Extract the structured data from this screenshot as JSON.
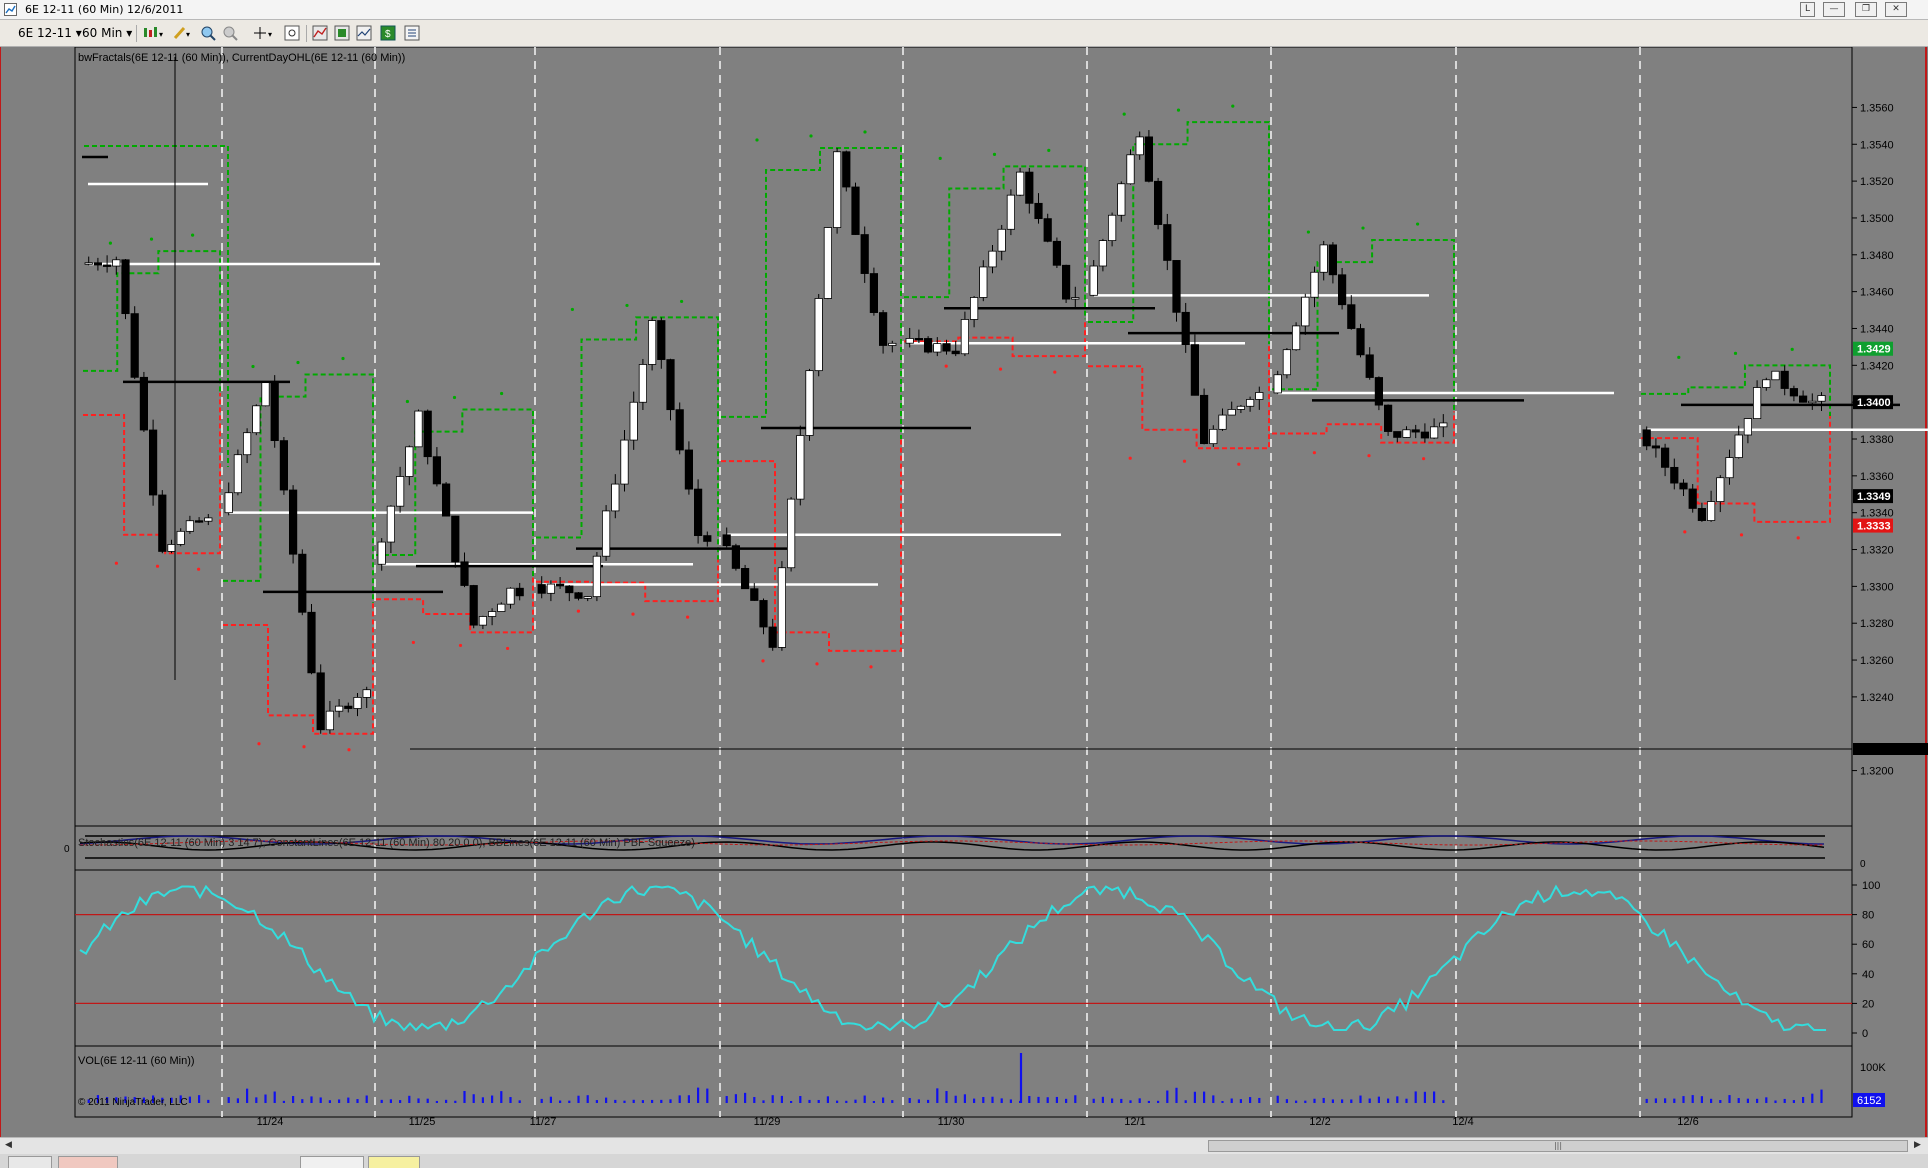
{
  "window": {
    "title": "6E 12-11 (60 Min)  12/6/2011",
    "link_button": "L",
    "minimize_label": "—",
    "restore_label": "❐",
    "close_label": "✕"
  },
  "toolbar": {
    "instrument": "6E 12-11",
    "interval": "60 Min"
  },
  "panels": {
    "price_label": "bwFractals(6E 12-11 (60 Min)), CurrentDayOHL(6E 12-11 (60 Min))",
    "stoch_label": "Stochastics(6E 12-11 (60 Min) 3 14 7), ConstantLines(6E 12-11 (60 Min) 80 20 0 0), BBLines(6E 12-11 (60 Min) PBF Squeeze)",
    "stoch_zero_label": "0",
    "stoch_axis_zero": "0",
    "vol_label": "VOL(6E 12-11 (60 Min))",
    "copyright": "© 2011 NinjaTrader, LLC"
  },
  "colors": {
    "chart_bg": "#808080",
    "bull_candle": "#ffffff",
    "bear_candle": "#000000",
    "fractal_up": "#00aa00",
    "fractal_down": "#ff2020",
    "stochastic": "#33dddd",
    "volume": "#1010ee",
    "grid_dash": "#d8d8d8",
    "constant_line": "#c01818"
  },
  "price_axis": {
    "ticks": [
      "1.3560",
      "1.3540",
      "1.3520",
      "1.3500",
      "1.3480",
      "1.3460",
      "1.3440",
      "1.3420",
      "1.3400",
      "1.3380",
      "1.3360",
      "1.3340",
      "1.3320",
      "1.3300",
      "1.3280",
      "1.3260",
      "1.3240",
      "1.3200"
    ],
    "markers": [
      {
        "text": "1.3429",
        "bg": "#0f9f2f",
        "fg": "#ffffff",
        "price": 1.3429
      },
      {
        "text": "1.3400",
        "bg": "#000000",
        "fg": "#ffffff",
        "price": 1.34
      },
      {
        "text": "1.3349",
        "bg": "#000000",
        "fg": "#ffffff",
        "price": 1.3349
      },
      {
        "text": "1.3333",
        "bg": "#e21515",
        "fg": "#ffffff",
        "price": 1.3333
      }
    ]
  },
  "stoch_axis": {
    "ticks": [
      "100",
      "80",
      "60",
      "40",
      "20",
      "0"
    ]
  },
  "vol_axis": {
    "tick": "100K",
    "marker": "6152"
  },
  "x_axis": {
    "dates": [
      "11/24",
      "11/25",
      "11/27",
      "11/29",
      "11/30",
      "12/1",
      "12/2",
      "12/4",
      "12/6"
    ]
  },
  "chart_data": {
    "type": "candlestick",
    "instrument": "6E 12-11",
    "interval": "60 Min",
    "ylim": [
      1.319,
      1.357
    ],
    "stoch_levels": [
      80,
      20
    ],
    "sessions": [
      {
        "date": "11/24",
        "o": 1.3475,
        "c": 1.3335,
        "h": 1.3482,
        "l": 1.3318
      },
      {
        "date": "11/25",
        "o": 1.334,
        "c": 1.3242,
        "h": 1.3415,
        "l": 1.322
      },
      {
        "date": "11/27",
        "o": 1.3312,
        "c": 1.3298,
        "h": 1.3396,
        "l": 1.3275
      },
      {
        "date": "11/29",
        "o": 1.3301,
        "c": 1.3328,
        "h": 1.3446,
        "l": 1.3292
      },
      {
        "date": "11/30",
        "o": 1.3328,
        "c": 1.3432,
        "h": 1.3538,
        "l": 1.3265
      },
      {
        "date": "12/1",
        "o": 1.3432,
        "c": 1.3458,
        "h": 1.3528,
        "l": 1.3425
      },
      {
        "date": "12/2",
        "o": 1.3458,
        "c": 1.3405,
        "h": 1.3552,
        "l": 1.3375
      },
      {
        "date": "12/4",
        "o": 1.3405,
        "c": 1.3385,
        "h": 1.3488,
        "l": 1.3378
      },
      {
        "date": "12/6",
        "o": 1.3385,
        "c": 1.34,
        "h": 1.342,
        "l": 1.3335
      }
    ]
  }
}
